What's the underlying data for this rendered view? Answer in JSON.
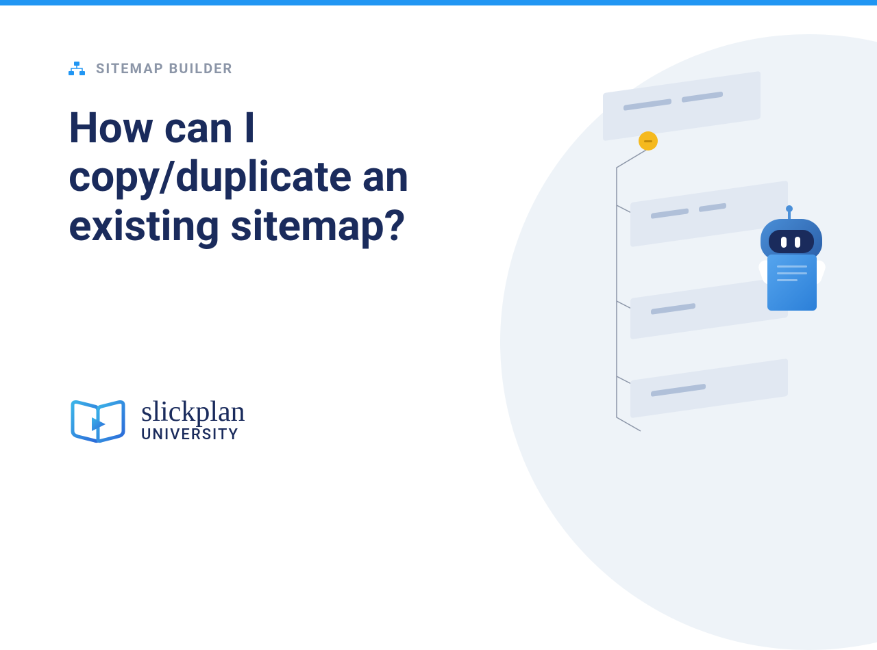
{
  "top_bar_color": "#2196f3",
  "category": {
    "icon": "sitemap-icon",
    "label": "SITEMAP BUILDER"
  },
  "headline": "How can I copy/duplicate an existing sitemap?",
  "brand": {
    "name": "slickplan",
    "sub": "UNIVERSITY"
  }
}
